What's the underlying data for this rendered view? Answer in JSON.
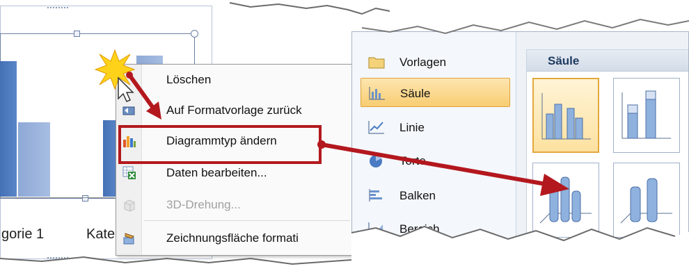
{
  "chart": {
    "category_labels": [
      "gorie 1",
      "Kate"
    ]
  },
  "context_menu": {
    "items": [
      {
        "label": "Löschen",
        "icon": "delete-icon",
        "enabled": true
      },
      {
        "label": "Auf Formatvorlage zurück",
        "icon": "reset-style-icon",
        "enabled": true
      },
      {
        "label": "Diagrammtyp ändern",
        "icon": "chart-type-icon",
        "enabled": true
      },
      {
        "label": "Daten bearbeiten...",
        "icon": "edit-data-icon",
        "enabled": true
      },
      {
        "label": "3D-Drehung...",
        "icon": "3d-rotation-icon",
        "enabled": false
      },
      {
        "label": "Zeichnungsfläche formati",
        "icon": "format-plot-area-icon",
        "enabled": true
      }
    ]
  },
  "dialog": {
    "categories": [
      {
        "label": "Vorlagen",
        "icon": "folder-icon"
      },
      {
        "label": "Säule",
        "icon": "column-chart-icon",
        "selected": true
      },
      {
        "label": "Linie",
        "icon": "line-chart-icon"
      },
      {
        "label": "Torte",
        "icon": "pie-chart-icon"
      },
      {
        "label": "Balken",
        "icon": "bar-chart-icon"
      },
      {
        "label": "Bereich",
        "icon": "area-chart-icon"
      }
    ],
    "section_title": "Säule"
  },
  "colors": {
    "accent_red": "#b3181e",
    "selection_orange": "#f8cd72",
    "bar_blue": "#4470b5",
    "bar_light_blue": "#a7bde2"
  }
}
